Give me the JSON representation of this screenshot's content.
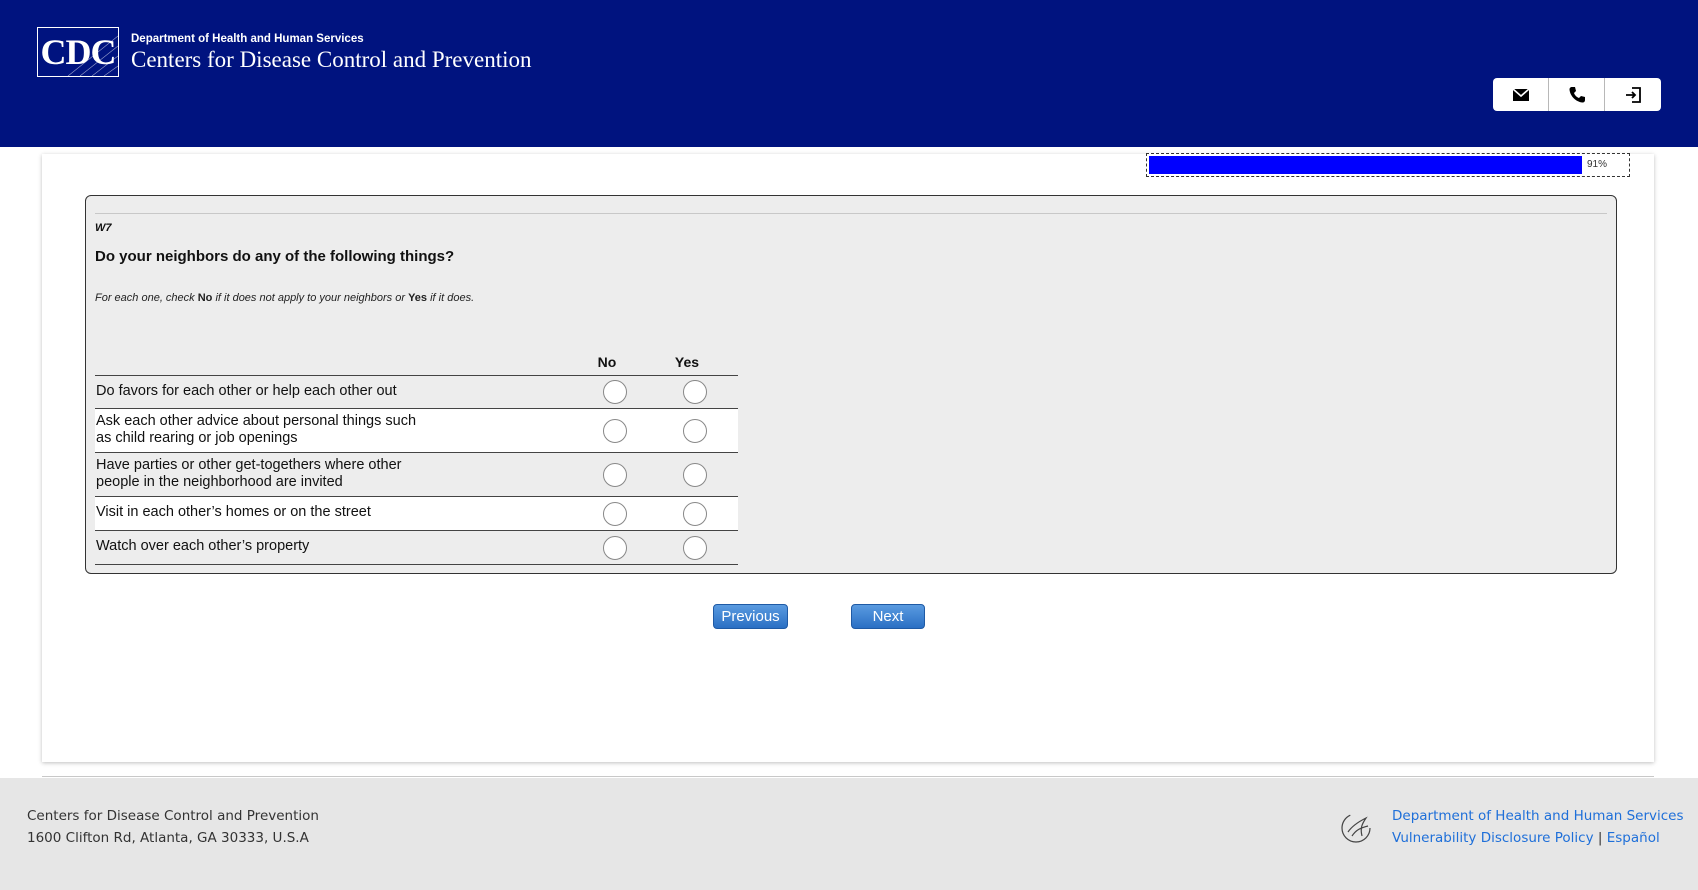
{
  "header": {
    "logo_text": "CDC",
    "dept": "Department of Health and Human Services",
    "org": "Centers for Disease Control and Prevention",
    "buttons": [
      {
        "name": "email-button",
        "icon": "mail-icon"
      },
      {
        "name": "phone-button",
        "icon": "phone-icon"
      },
      {
        "name": "exit-button",
        "icon": "exit-icon"
      }
    ]
  },
  "progress": {
    "label": "91%",
    "value": 91
  },
  "question": {
    "id": "W7",
    "text": "Do your neighbors do any of the following things?",
    "instr_1": "For each one, check ",
    "instr_no": "No",
    "instr_2": " if it does not apply to your neighbors or ",
    "instr_yes": "Yes",
    "instr_3": " if it does.",
    "col_no": "No",
    "col_yes": "Yes",
    "rows": [
      "Do favors for each other or help each other out",
      "Ask each other advice about personal things such as child rearing or job openings",
      "Have parties or other get-togethers where other people in the neighborhood are invited",
      "Visit in each other’s homes or on the street",
      "Watch over each other’s property"
    ]
  },
  "nav": {
    "previous": "Previous",
    "next": "Next"
  },
  "footer": {
    "org": "Centers for Disease Control and Prevention",
    "address": "1600 Clifton Rd, Atlanta, GA 30333, U.S.A",
    "hhs_link": "Department of Health and Human Services",
    "vdp_link": "Vulnerability Disclosure Policy",
    "separator": " | ",
    "espanol_link": "Español"
  },
  "colors": {
    "header_bg": "#00137f",
    "progress_fill": "#0000ff",
    "button_blue": "#2a6fc4",
    "link": "#1e6fd9"
  }
}
